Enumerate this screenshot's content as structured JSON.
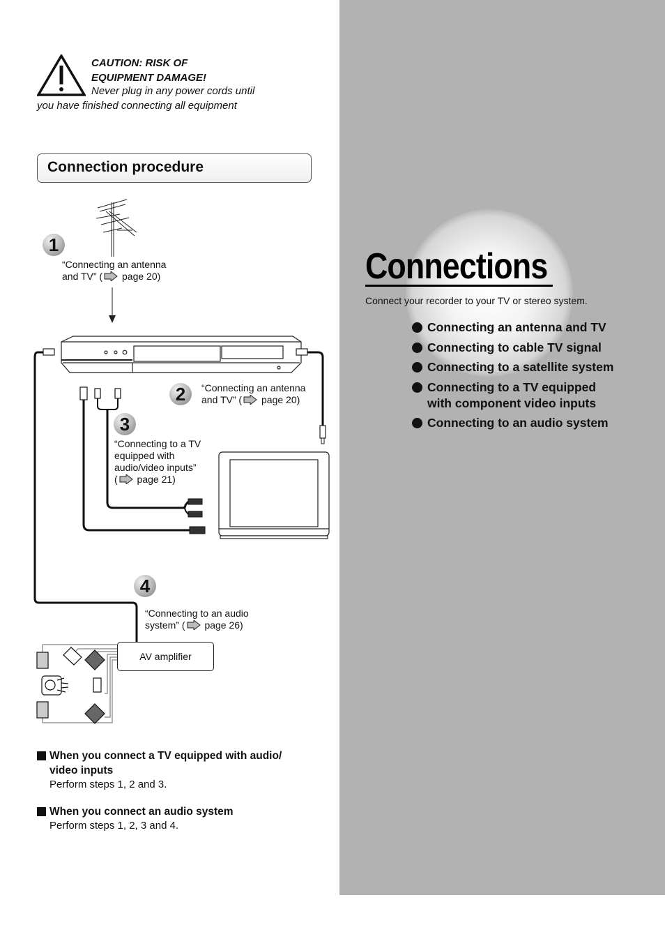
{
  "caution": {
    "icon": "warning-triangle-icon",
    "title_line1": "CAUTION: RISK OF",
    "title_line2": "EQUIPMENT DAMAGE!",
    "text": "Never plug in any power cords until you have finished connecting all equipment"
  },
  "section": {
    "title": "Connection procedure"
  },
  "steps": [
    {
      "number": "1",
      "ref_line1": "“Connecting an antenna",
      "ref_pre": "and TV” (",
      "ref_page": " page 20)"
    },
    {
      "number": "2",
      "ref_line1": "“Connecting an antenna",
      "ref_pre": "and TV” (",
      "ref_page": " page 20)"
    },
    {
      "number": "3",
      "ref_line1": "“Connecting to a TV",
      "ref_line2": "equipped with",
      "ref_line3": "audio/video inputs”",
      "ref_pre": "(",
      "ref_page": " page 21)"
    },
    {
      "number": "4",
      "ref_line1": "“Connecting to an audio",
      "ref_pre": "system” (",
      "ref_page": " page 26)"
    }
  ],
  "diagram": {
    "devices": [
      "antenna",
      "recorder",
      "tv",
      "av-amplifier",
      "speakers"
    ],
    "amplifier_label": "AV amplifier"
  },
  "notes": [
    {
      "heading_line1": "When you connect a TV equipped with audio/",
      "heading_line2": "video inputs",
      "body": "Perform steps 1, 2 and 3."
    },
    {
      "heading_line1": "When you connect an audio system",
      "body": "Perform steps 1, 2, 3 and 4."
    }
  ],
  "right_panel": {
    "title": "Connections",
    "subtitle": "Connect your recorder to your TV or stereo system.",
    "topics": [
      "Connecting an antenna and TV",
      "Connecting to cable TV signal",
      "Connecting to a satellite system",
      "Connecting to a TV equipped with component video inputs",
      "Connecting to an audio system"
    ],
    "colors": {
      "panel": "#b2b2b2",
      "text": "#111111"
    }
  }
}
